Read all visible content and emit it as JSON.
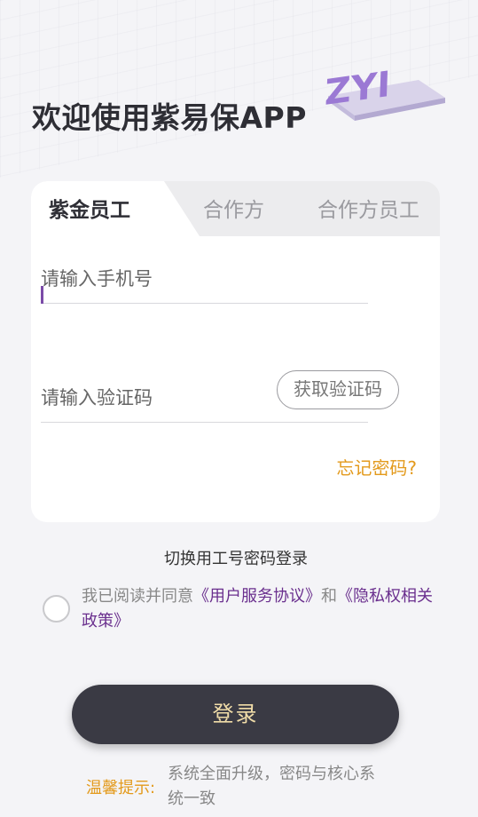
{
  "header": {
    "welcome": "欢迎使用紫易保APP",
    "logo_text": "ZYI"
  },
  "tabs": [
    {
      "label": "紫金员工",
      "active": true
    },
    {
      "label": "合作方",
      "active": false
    },
    {
      "label": "合作方员工",
      "active": false
    }
  ],
  "form": {
    "phone_placeholder": "请输入手机号",
    "code_placeholder": "请输入验证码",
    "get_code_label": "获取验证码",
    "forgot_label": "忘记密码?"
  },
  "switch_login_label": "切换用工号密码登录",
  "agreement": {
    "prefix": "我已阅读并同意",
    "terms_link": "《用户服务协议》",
    "and": "和",
    "privacy_link": "《隐私权相关政策》",
    "checked": false
  },
  "login_label": "登录",
  "tip": {
    "label": "温馨提示:",
    "text": "系统全面升级，密码与核心系统一致"
  },
  "colors": {
    "accent": "#e39a1c",
    "brand": "#6a2f8e",
    "button_bg": "#3a3a44",
    "button_text": "#f0dca8"
  }
}
